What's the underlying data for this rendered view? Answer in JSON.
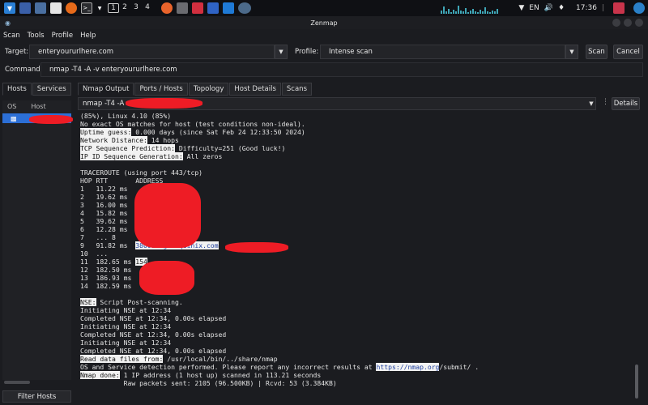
{
  "taskbar": {
    "workspaces": [
      "1",
      "2",
      "3",
      "4"
    ],
    "language": "EN",
    "clock": "17:36"
  },
  "window": {
    "title": "Zenmap"
  },
  "menu": [
    "Scan",
    "Tools",
    "Profile",
    "Help"
  ],
  "target": {
    "label": "Target:",
    "value": "enteryoururlhere.com",
    "profile_label": "Profile:",
    "profile_value": "Intense scan",
    "scan_button": "Scan",
    "cancel_button": "Cancel"
  },
  "command": {
    "label": "Command:",
    "value": "nmap -T4 -A -v enteryoururlhere.com"
  },
  "left": {
    "tab_hosts": "Hosts",
    "tab_services": "Services",
    "col_os": "OS",
    "col_host": "Host",
    "filter_button": "Filter Hosts"
  },
  "right": {
    "tabs": [
      "Nmap Output",
      "Ports / Hosts",
      "Topology",
      "Host Details",
      "Scans"
    ],
    "command_select": "nmap -T4 -A",
    "details_button": "Details"
  },
  "output": {
    "line1": "(85%), Linux 4.10 (85%)",
    "line2": "No exact OS matches for host (test conditions non-ideal).",
    "uptime_label": "Uptime guess:",
    "uptime_value": " 0.000 days (since Sat Feb 24 12:33:50 2024)",
    "netdist_label": "Network Distance:",
    "netdist_value": " 14 hops",
    "tcpseq_label": "TCP Sequence Prediction:",
    "tcpseq_value": " Difficulty=251 (Good luck!)",
    "ipid_label": "IP ID Sequence Generation:",
    "ipid_value": " All zeros",
    "traceroute": "TRACEROUTE (using port 443/tcp)",
    "trace_header": "HOP RTT       ADDRESS",
    "hops": [
      "1   11.22 ms",
      "2   19.62 ms",
      "3   16.00 ms",
      "4   15.82 ms",
      "5   39.62 ms",
      "6   12.28 ms",
      "7   ... 8",
      "9   91.82 ms  ",
      "10  ...",
      "11  182.65 ms ",
      "12  182.50 ms",
      "13  186.93 ms",
      "14  182.59 ms"
    ],
    "hop9_link": "38001.sgw.equinix.com",
    "hop11_addr": "154",
    "nse_label": "NSE:",
    "nse_value": " Script Post-scanning.",
    "nse_lines": [
      "Initiating NSE at 12:34",
      "Completed NSE at 12:34, 0.00s elapsed",
      "Initiating NSE at 12:34",
      "Completed NSE at 12:34, 0.00s elapsed",
      "Initiating NSE at 12:34",
      "Completed NSE at 12:34, 0.00s elapsed"
    ],
    "readdata_label": "Read data files from:",
    "readdata_value": " /usr/local/bin/../share/nmap",
    "osdetect_pre": "OS and Service detection performed. Please report any incorrect results at ",
    "osdetect_link": "https://nmap.org",
    "osdetect_post": "/submit/ .",
    "done_label": "Nmap done:",
    "done_value": " 1 IP address (1 host up) scanned in 113.21 seconds",
    "raw_packets": "           Raw packets sent: 2105 (96.500KB) | Rcvd: 53 (3.384KB)"
  }
}
